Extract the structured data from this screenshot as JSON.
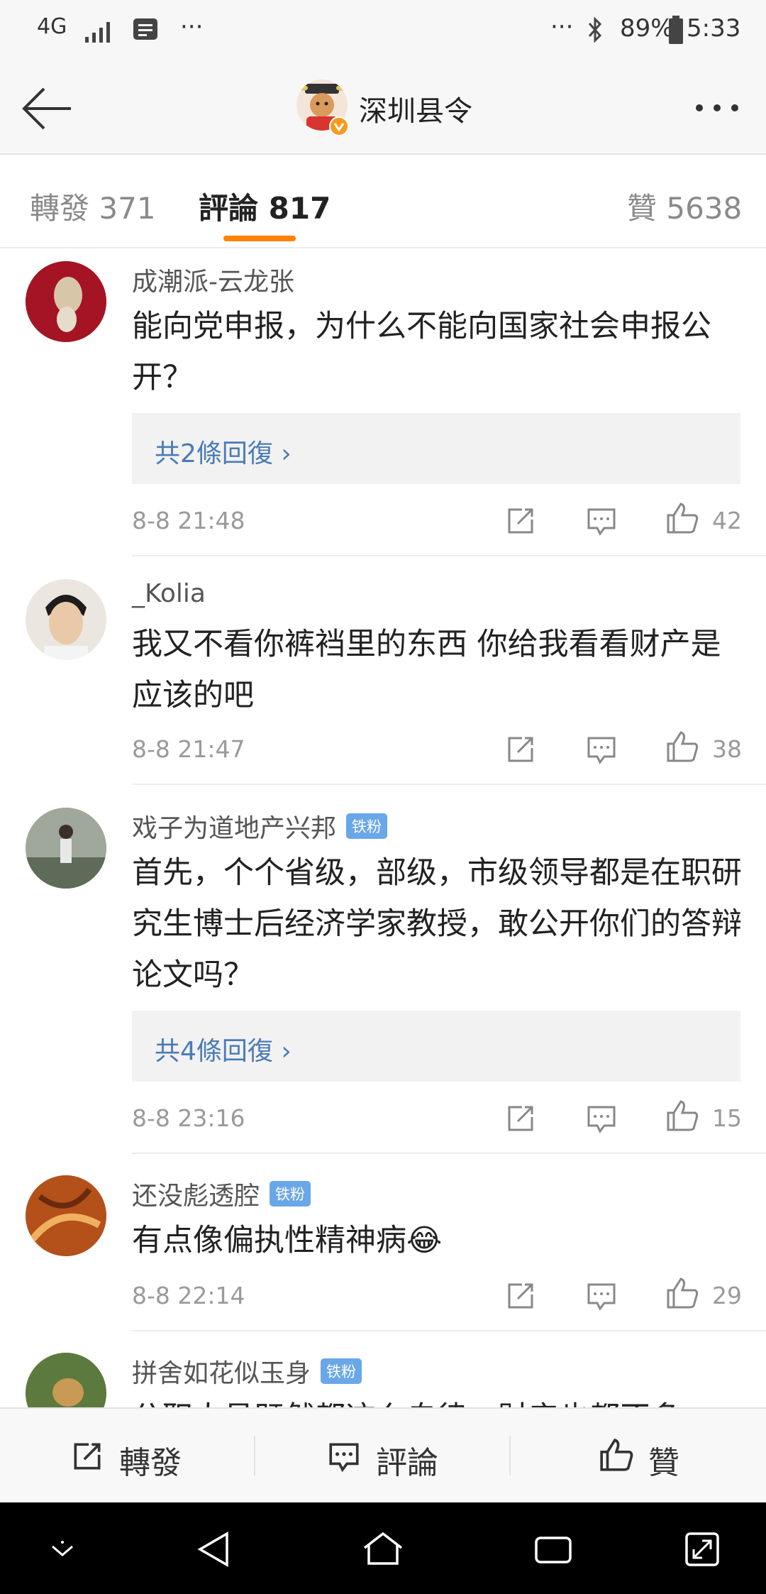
{
  "status": {
    "network": "4G",
    "signal": "signal-icon",
    "battery": "89%",
    "time": "5:33",
    "more": "···"
  },
  "header": {
    "title": "深圳县令"
  },
  "tabs": [
    {
      "label": "轉發",
      "count": "371"
    },
    {
      "label": "評論",
      "count": "817"
    },
    {
      "label": "贊",
      "count": "5638"
    }
  ],
  "comments": [
    {
      "user": "成潮派-云龙张",
      "text": "能向党申报，为什么不能向国家社会申报公开？",
      "replies": "共2條回復 ›",
      "time": "8-8 21:48",
      "likes": "42"
    },
    {
      "user": "_Kolia",
      "text": "我又不看你裤裆里的东西 你给我看看财产是应该的吧",
      "time": "8-8 21:47",
      "likes": "38"
    },
    {
      "user": "戏子为道地产兴邦",
      "badge": "铁粉",
      "text": "首先，个个省级，部级，市级领导都是在职研究生博士后经济学家教授，敢公开你们的答辩论文吗？",
      "replies": "共4條回復 ›",
      "time": "8-8 23:16",
      "likes": "15"
    },
    {
      "user": "还没彪透腔",
      "badge": "铁粉",
      "text": "有点像偏执性精神病",
      "emoji": "😂",
      "time": "8-8 22:14",
      "likes": "29"
    },
    {
      "user": "拼舍如花似玉身",
      "badge": "铁粉",
      "text": "公职人员既然都这么自律，财产也都不多"
    }
  ],
  "actions": {
    "repost": "轉發",
    "comment": "評論",
    "like": "贊"
  },
  "colors": {
    "accent": "#ff8200",
    "link": "#4a7bb5",
    "badge": "#6aa7e8"
  }
}
